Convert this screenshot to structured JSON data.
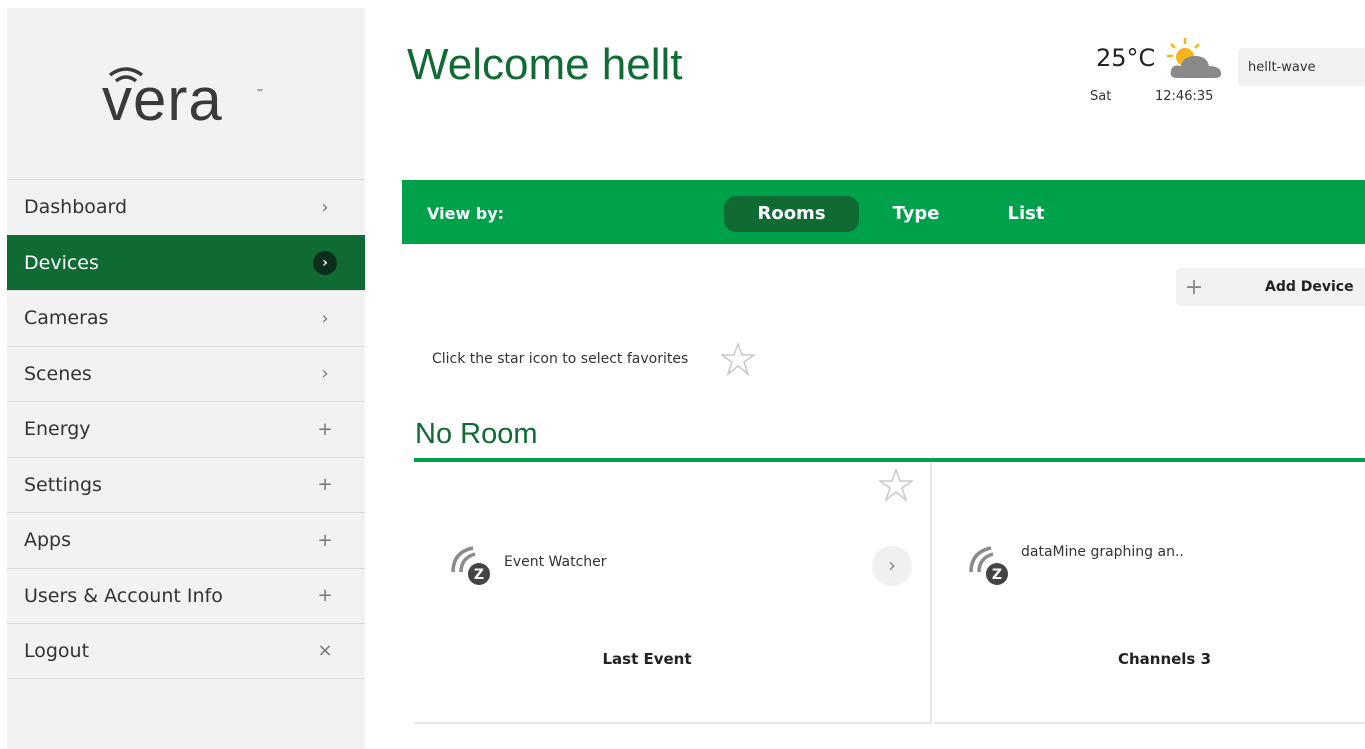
{
  "brand": {
    "logo_text": "vera",
    "trademark": "™"
  },
  "header": {
    "welcome": "Welcome hellt",
    "temperature": "25°C",
    "day": "Sat",
    "time": "12:46:35",
    "username": "hellt-wave"
  },
  "sidebar": {
    "items": [
      {
        "label": "Dashboard",
        "indicator": "›"
      },
      {
        "label": "Devices",
        "indicator": "›"
      },
      {
        "label": "Cameras",
        "indicator": "›"
      },
      {
        "label": "Scenes",
        "indicator": "›"
      },
      {
        "label": "Energy",
        "indicator": "+"
      },
      {
        "label": "Settings",
        "indicator": "+"
      },
      {
        "label": "Apps",
        "indicator": "+"
      },
      {
        "label": "Users & Account Info",
        "indicator": "+"
      },
      {
        "label": "Logout",
        "indicator": "×"
      }
    ],
    "active_item": "Devices"
  },
  "viewbar": {
    "label": "View by:",
    "tabs": [
      {
        "label": "Rooms",
        "selected": true
      },
      {
        "label": "Type",
        "selected": false
      },
      {
        "label": "List",
        "selected": false
      }
    ]
  },
  "toolbar": {
    "add_icon": "+",
    "add_label": "Add Device"
  },
  "favorites": {
    "hint": "Click the star icon to select favorites"
  },
  "room": {
    "title": "No Room",
    "devices": [
      {
        "name": "Event Watcher",
        "footer": "Last Event",
        "icon": "zwave-icon"
      },
      {
        "name": "dataMine graphing an..",
        "footer": "Channels 3",
        "icon": "zwave-icon"
      }
    ]
  },
  "colors": {
    "brand_green": "#00a14b",
    "dark_green": "#0f6b33"
  }
}
